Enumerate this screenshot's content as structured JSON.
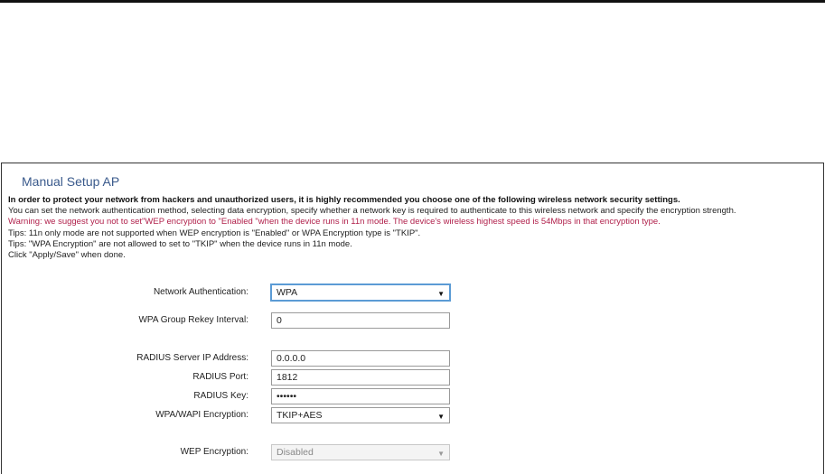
{
  "panel": {
    "title": "Manual Setup AP"
  },
  "intro": {
    "line1": "In order to protect your network from hackers and unauthorized users, it is highly recommended you choose one of the following wireless network security settings.",
    "line2": "You can set the network authentication method, selecting data encryption, specify whether a network key is required to authenticate to this wireless network and specify the encryption strength.",
    "warning": "Warning: we suggest you not to set\"WEP encryption to \"Enabled \"when the device runs in 11n mode. The device's wireless highest speed is 54Mbps in that encryption type.",
    "tip1": "Tips: 11n only mode are not supported when WEP encryption is \"Enabled\" or WPA Encryption type is \"TKIP\".",
    "tip2": "Tips: \"WPA Encryption\" are not allowed to set to \"TKIP\" when the device runs in 11n mode.",
    "done": "Click \"Apply/Save\" when done."
  },
  "form": {
    "network_auth": {
      "label": "Network Authentication:",
      "value": "WPA"
    },
    "rekey_interval": {
      "label": "WPA Group Rekey Interval:",
      "value": "0"
    },
    "radius_ip": {
      "label": "RADIUS Server IP Address:",
      "value": "0.0.0.0"
    },
    "radius_port": {
      "label": "RADIUS Port:",
      "value": "1812"
    },
    "radius_key": {
      "label": "RADIUS Key:",
      "value": "••••••"
    },
    "wpa_encryption": {
      "label": "WPA/WAPI Encryption:",
      "value": "TKIP+AES"
    },
    "wep_encryption": {
      "label": "WEP Encryption:",
      "value": "Disabled"
    }
  },
  "icons": {
    "dropdown_arrow": "chevron-down-icon"
  },
  "colors": {
    "title": "#3a5a8c",
    "warning": "#b01f4a",
    "focus": "#5b9bd5"
  }
}
